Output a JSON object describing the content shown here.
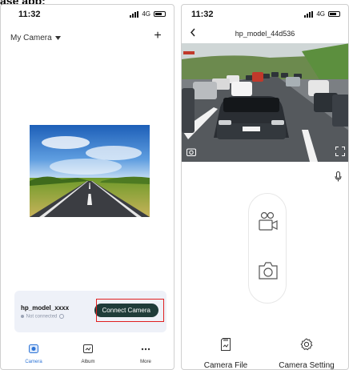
{
  "caption": "ase app:",
  "left": {
    "status": {
      "time": "11:32",
      "network": "4G"
    },
    "header": {
      "camera_select": "My Camera",
      "add_label": "+"
    },
    "card": {
      "model": "hp_model_xxxx",
      "status": "Not connected",
      "button": "Connect Camera"
    },
    "tabs": [
      {
        "label": "Camera"
      },
      {
        "label": "Album"
      },
      {
        "label": "More"
      }
    ]
  },
  "right": {
    "status": {
      "time": "11:32",
      "network": "4G"
    },
    "header": {
      "title": "hp_model_44d536"
    },
    "bottom": {
      "file_label": "Camera File",
      "setting_label": "Camera Setting"
    }
  },
  "colors": {
    "accent_blue": "#2d74d6",
    "connect_button": "#1f3c39",
    "highlight_red": "#e02020",
    "card_bg": "#eef1f8"
  }
}
